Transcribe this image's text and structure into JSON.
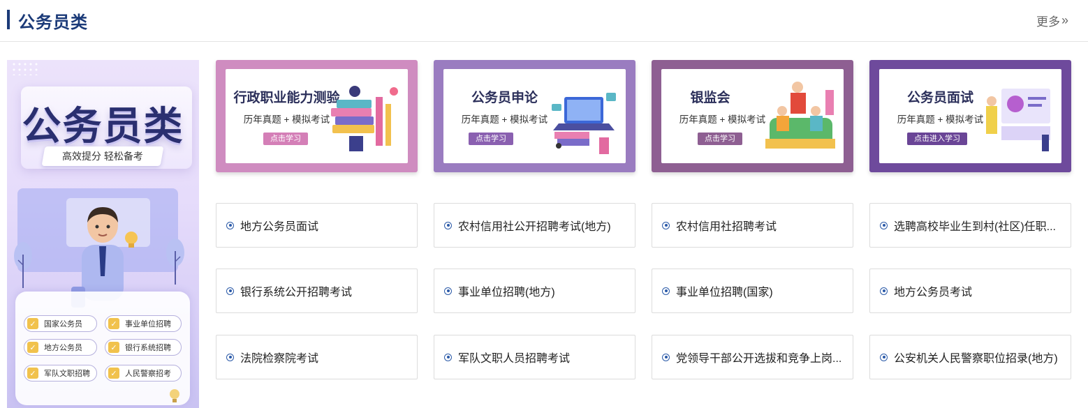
{
  "header": {
    "title": "公务员类",
    "more_label": "更多"
  },
  "promo": {
    "title": "公务员类",
    "slogan": "高效提分  轻松备考",
    "tags": [
      "国家公务员",
      "事业单位招聘",
      "地方公务员",
      "银行系统招聘",
      "军队文职招聘",
      "人民警察招考"
    ]
  },
  "cards": [
    {
      "title": "行政职业能力测验",
      "subtitle": "历年真题 + 模拟考试",
      "button": "点击学习",
      "frame_color": "#cf8cc0",
      "button_color": "#d47fb7"
    },
    {
      "title": "公务员申论",
      "subtitle": "历年真题 + 模拟考试",
      "button": "点击学习",
      "frame_color": "#9a7cc0",
      "button_color": "#8a60b0"
    },
    {
      "title": "银监会",
      "subtitle": "历年真题 + 模拟考试",
      "button": "点击学习",
      "frame_color": "#8e5f92",
      "button_color": "#8e5f92"
    },
    {
      "title": "公务员面试",
      "subtitle": "历年真题 + 模拟考试",
      "button": "点击进入学习",
      "frame_color": "#6e4a9c",
      "button_color": "#6a4596"
    }
  ],
  "exams": [
    "地方公务员面试",
    "农村信用社公开招聘考试(地方)",
    "农村信用社招聘考试",
    "选聘高校毕业生到村(社区)任职...",
    "银行系统公开招聘考试",
    "事业单位招聘(地方)",
    "事业单位招聘(国家)",
    "地方公务员考试",
    "法院检察院考试",
    "军队文职人员招聘考试",
    "党领导干部公开选拔和竞争上岗...",
    "公安机关人民警察职位招录(地方)"
  ]
}
